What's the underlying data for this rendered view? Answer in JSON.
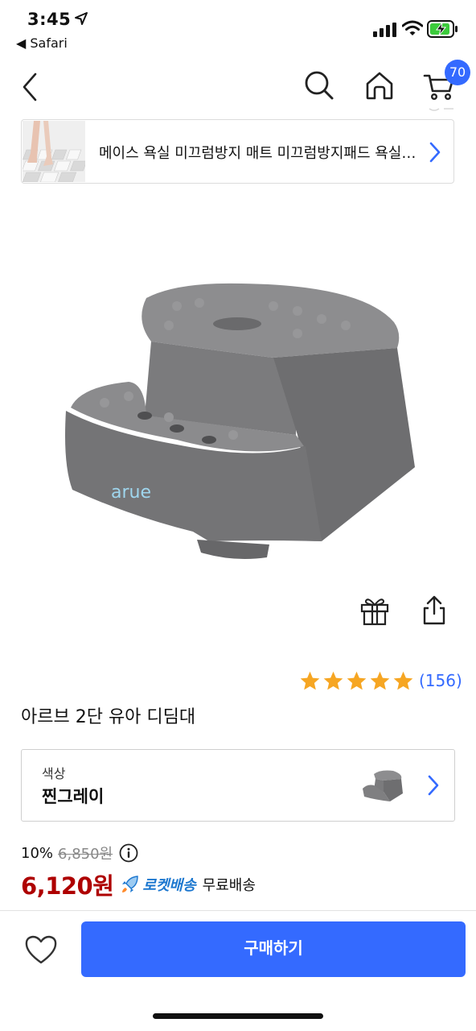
{
  "status_bar": {
    "time": "3:45",
    "back_app": "◀ Safari",
    "icons": [
      "location-arrow",
      "cellular-signal",
      "wifi",
      "battery-charging"
    ]
  },
  "nav": {
    "icons": [
      "back-chevron",
      "search",
      "home",
      "cart"
    ],
    "cart_count": "70"
  },
  "related_banner": {
    "text": "메이스 욕실 미끄럼방지 매트 미끄럼방지패드 욕실매트",
    "icon": "chevron-right"
  },
  "product": {
    "brand_logo": "arue",
    "title": "아르브 2단 유아 디딤대",
    "rating": 5,
    "review_count": "(156)",
    "action_icons": [
      "gift",
      "share"
    ]
  },
  "option": {
    "label": "색상",
    "value": "찐그레이"
  },
  "price": {
    "discount_rate": "10%",
    "original_price": "6,850원",
    "sale_price": "6,120원",
    "rocket_label": "로켓배송",
    "shipping": "무료배송"
  },
  "bottom_bar": {
    "buy_label": "구매하기",
    "wish_icon": "heart"
  },
  "colors": {
    "accent": "#346aff",
    "price": "#ae0000",
    "star": "#f6a623",
    "rocket": "#1c77cf"
  }
}
